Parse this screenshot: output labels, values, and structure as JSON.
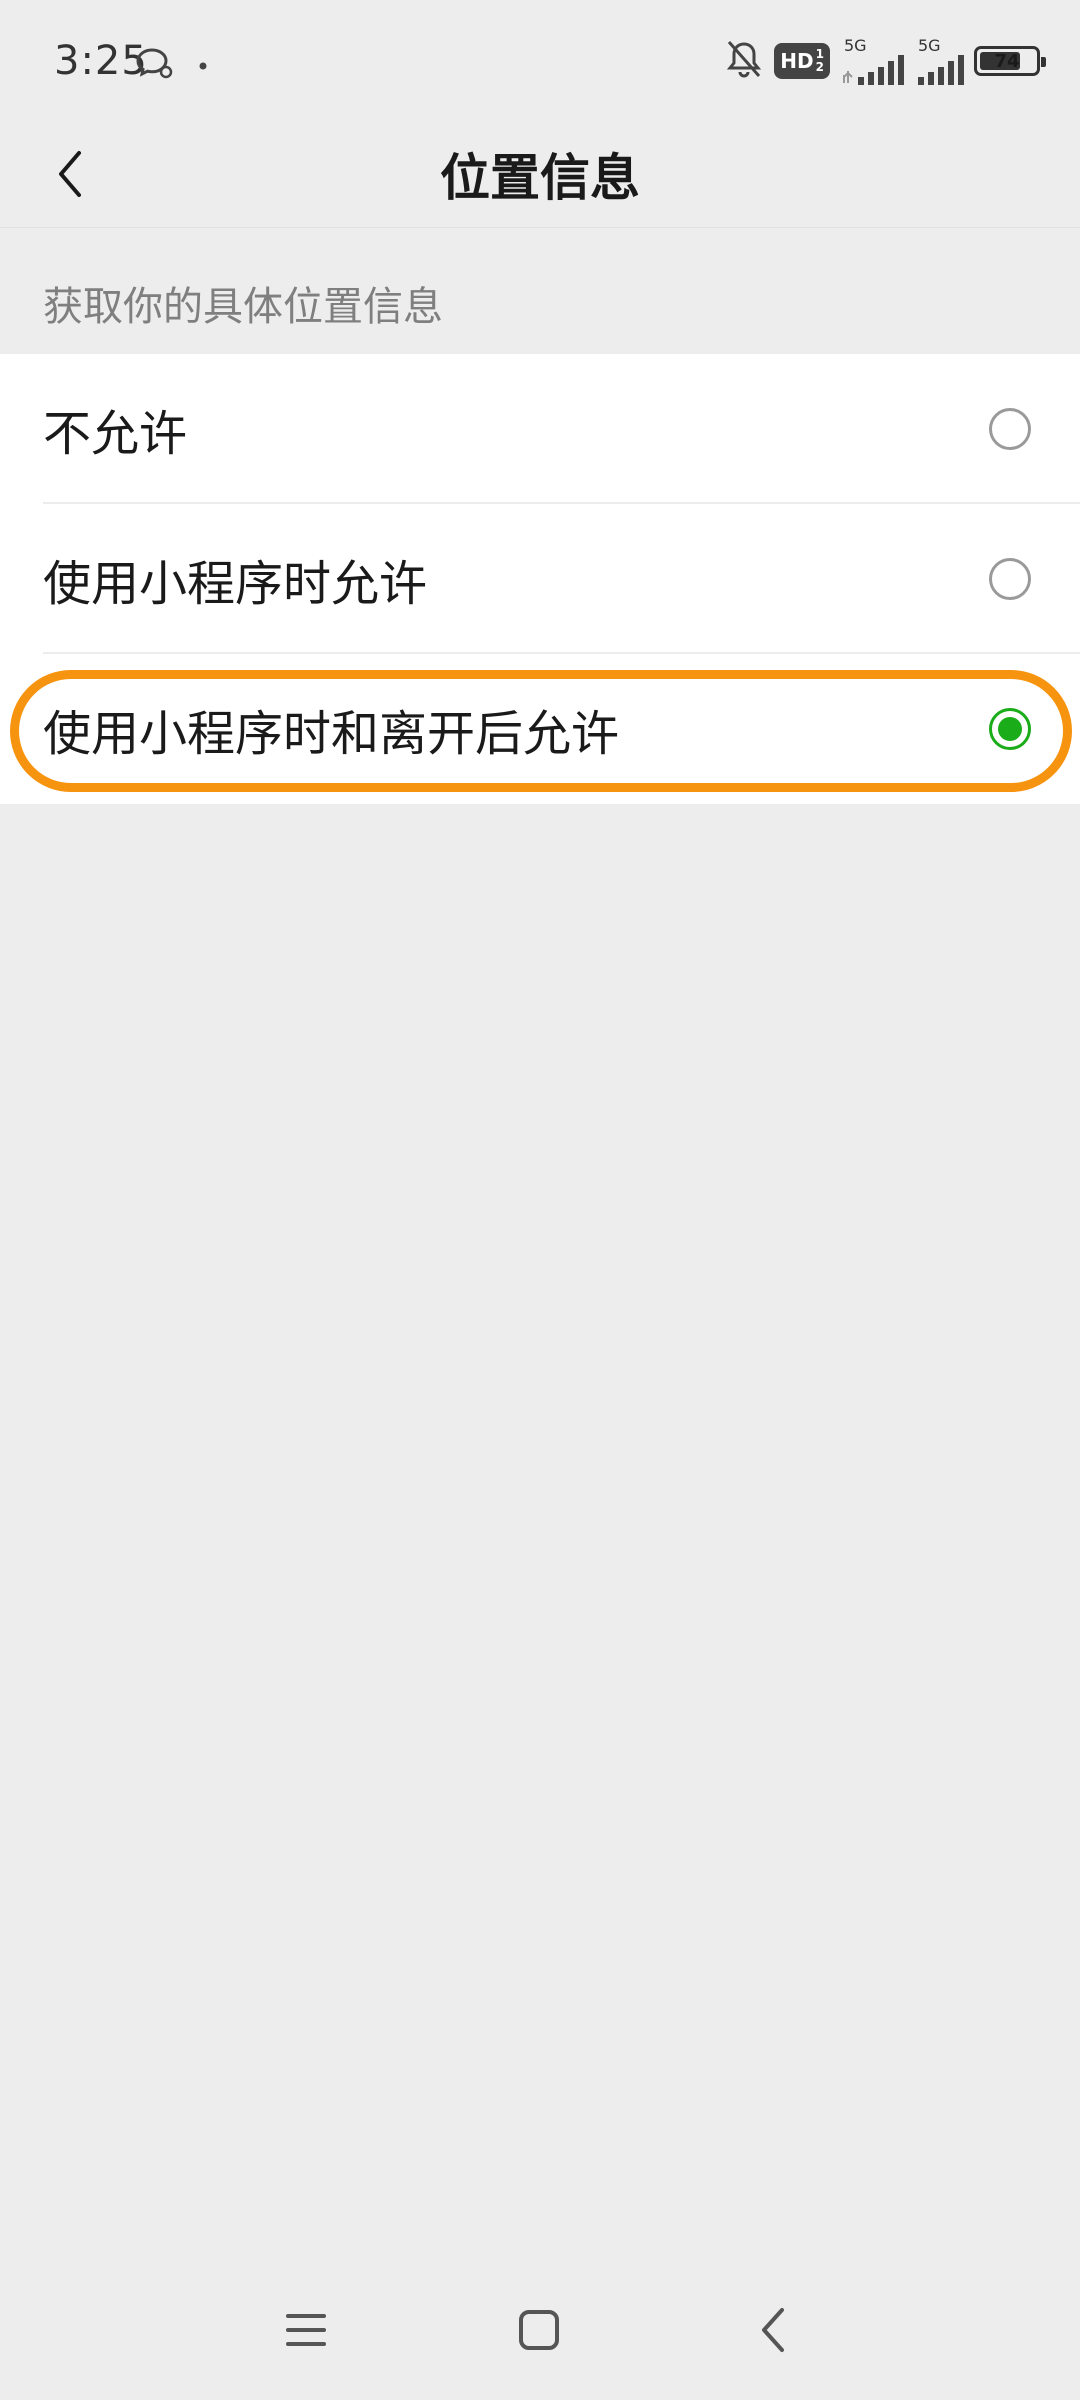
{
  "status_bar": {
    "time": "3:25",
    "network_1": "5G",
    "network_2": "5G",
    "hd_label": "HD",
    "hd_sub_top": "1",
    "hd_sub_bottom": "2",
    "battery_level": "74",
    "battery_fraction": 0.74,
    "icons": [
      "wechat-chat-icon",
      "dot-icon",
      "mute-bell-icon",
      "hd-voice-icon",
      "signal-icon",
      "signal-icon",
      "battery-icon"
    ]
  },
  "nav": {
    "title": "位置信息",
    "back_icon": "chevron-left-icon"
  },
  "section": {
    "header": "获取你的具体位置信息"
  },
  "options": [
    {
      "label": "不允许",
      "selected": false
    },
    {
      "label": "使用小程序时允许",
      "selected": false
    },
    {
      "label": "使用小程序时和离开后允许",
      "selected": true
    }
  ],
  "colors": {
    "accent_green": "#1aad19",
    "highlight_orange": "#f7940f",
    "background": "#ededed"
  },
  "system_nav": {
    "icons": [
      "menu-icon",
      "home-icon",
      "back-icon"
    ]
  }
}
